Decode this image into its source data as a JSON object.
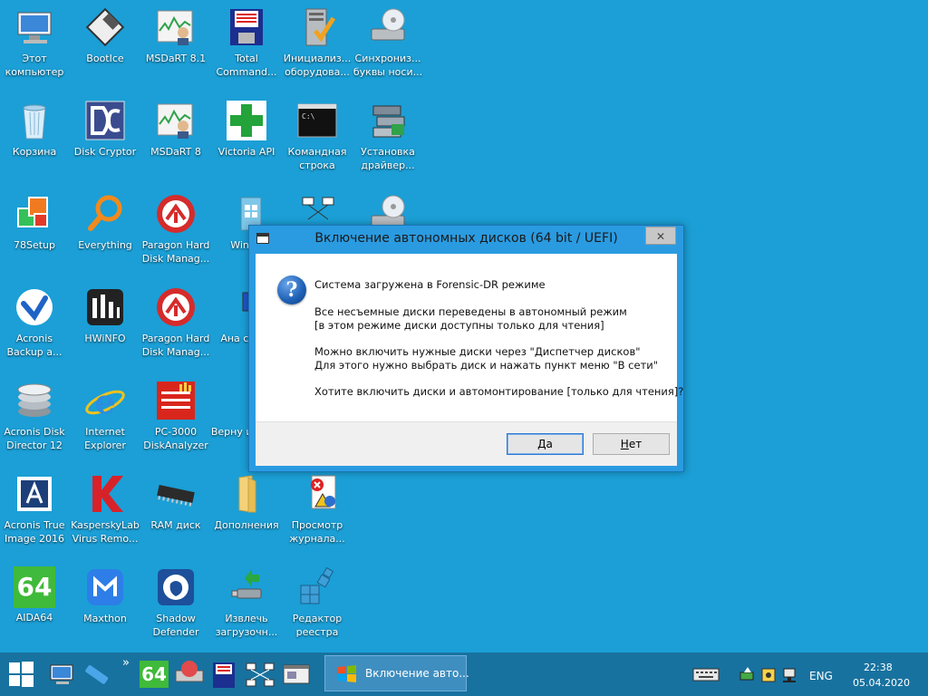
{
  "desktop_icons": {
    "this_pc": "Этот компьютер",
    "bootice": "BootIce",
    "msdart81": "MSDaRT 8.1",
    "total_commander": "Total Command...",
    "device_init": "Инициализ... оборудова...",
    "drive_letters_sync": "Синхрониз... буквы носи...",
    "recycle_bin": "Корзина",
    "disk_cryptor": "Disk Cryptor",
    "msdart8": "MSDaRT 8",
    "victoria_api": "Victoria API",
    "cmd": "Командная строка",
    "driver_install": "Установка драйвер...",
    "setup78": "78Setup",
    "everything": "Everything",
    "paragon1": "Paragon Hard Disk Manag...",
    "winnt": "WinNT",
    "acronis_backup": "Acronis Backup a...",
    "hwinfo": "HWiNFO",
    "paragon2": "Paragon Hard Disk Manag...",
    "system_analysis": "Ана систе",
    "acronis_disk_director": "Acronis Disk Director 12",
    "internet_explorer": "Internet Explorer",
    "pc3000": "PC-3000 DiskAnalyzer",
    "return_extract": "Верну извлеч",
    "acronis_true_image": "Acronis True Image 2016",
    "kaspersky": "KasperskyLab Virus Remo...",
    "ram_disk": "RAM диск",
    "addons": "Дополнения",
    "event_viewer": "Просмотр журнала...",
    "aida64": "AIDA64",
    "aida64_glyph": "64",
    "maxthon": "Maxthon",
    "shadow_defender": "Shadow Defender",
    "eject_boot": "Извлечь загрузочн...",
    "regedit": "Редактор реестра"
  },
  "dialog": {
    "title": "Включение автономных дисков (64 bit / UEFI)",
    "close_glyph": "✕",
    "question_glyph": "?",
    "line1": "Система загружена в Forensic-DR режиме",
    "line2": "Все несъемные диски переведены в автономный режим",
    "line3": "[в этом режиме диски доступны только для чтения]",
    "line4": "Можно включить нужные диски через \"Диспетчер дисков\"",
    "line5": "Для этого нужно выбрать диск и нажать пункт меню \"В сети\"",
    "line6": "Хотите включить диски и автомонтирование [только для чтения]?",
    "yes_u": "Д",
    "yes_rest": "а",
    "no_u": "Н",
    "no_rest": "ет"
  },
  "taskbar": {
    "overflow": "»",
    "aida_glyph": "64",
    "active_task_label": "Включение авто...",
    "lang": "ENG",
    "time": "22:38",
    "date": "05.04.2020"
  }
}
